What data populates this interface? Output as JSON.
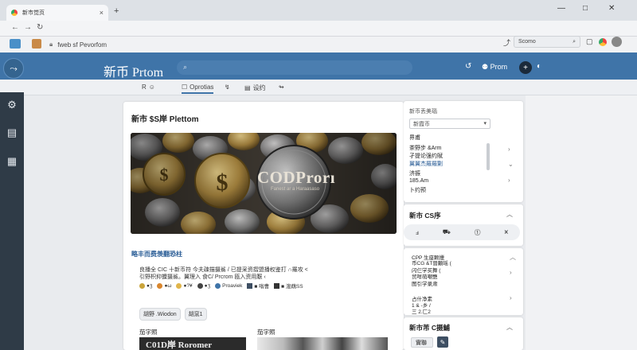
{
  "browser": {
    "tab_title": "新市觉页",
    "address": "fweb sf Pevorfom",
    "search_placeholder": "Scomo"
  },
  "app": {
    "brand": "新币 Prtom",
    "header_user": "Prom",
    "subnav": [
      {
        "icon": "R",
        "label": "☺"
      },
      {
        "icon": "☐",
        "label": "Oprotias"
      },
      {
        "icon": "↯",
        "label": ""
      },
      {
        "icon": "▤",
        "label": "设约"
      },
      {
        "icon": "↬",
        "label": ""
      }
    ]
  },
  "main": {
    "title": "新市 $S岸 Plettom",
    "hero_text": "CODProrı",
    "hero_sub": "Fanest ar a Haraasaso",
    "section_heading": "略丰而费羡翻恐柱",
    "paragraph": [
      "良播全 CIC 十新币符 今夫疎描摄鯊 / 已提采资摺盟播权鉴打 ∩羅攻 <",
      "引野枳抑攈摄鯊。翼理入 食C/ Prcrom 瓯入资用厭 ‹"
    ],
    "tags": [
      "●ʒ",
      "●ω",
      "●?¥",
      "●ʒ",
      "Proaviek",
      "■ 嗡曹",
      "■ 溲鵡SS"
    ],
    "chips": [
      "胡野 .Wiodon",
      "胡窯1"
    ],
    "sub_labels": [
      "茄字照",
      "茄字照"
    ],
    "thumb1_text": "C01D岸 Roromer"
  },
  "right": {
    "card1": {
      "title": "新币丢美瑙",
      "select": "新霞币",
      "lines": [
        "界甫",
        "茶野步 &Arm",
        "孑提论强约賦",
        "茵旺屈彝钓 彳搬",
        "济振",
        "185.Am",
        "卜约预"
      ],
      "link": "翼翼杰羅羅劗"
    },
    "card2": {
      "title": "新市 CS序",
      "tools": [
        "ⅎ",
        "⛟",
        "⓵",
        "⩙"
      ]
    },
    "card3": {
      "lines": [
        "CPP 生座颗擸",
        "币CG &T晉顆瑶 (",
        "闪仨学买舞 (",
        "贸咩萌嘲盬",
        "图引学录肃",
        "占什净素",
        "1 & -乡 /",
        "三 2.匚2"
      ]
    },
    "card4": {
      "title": "新市芾 C摄鯆",
      "chip": "實聯"
    }
  }
}
